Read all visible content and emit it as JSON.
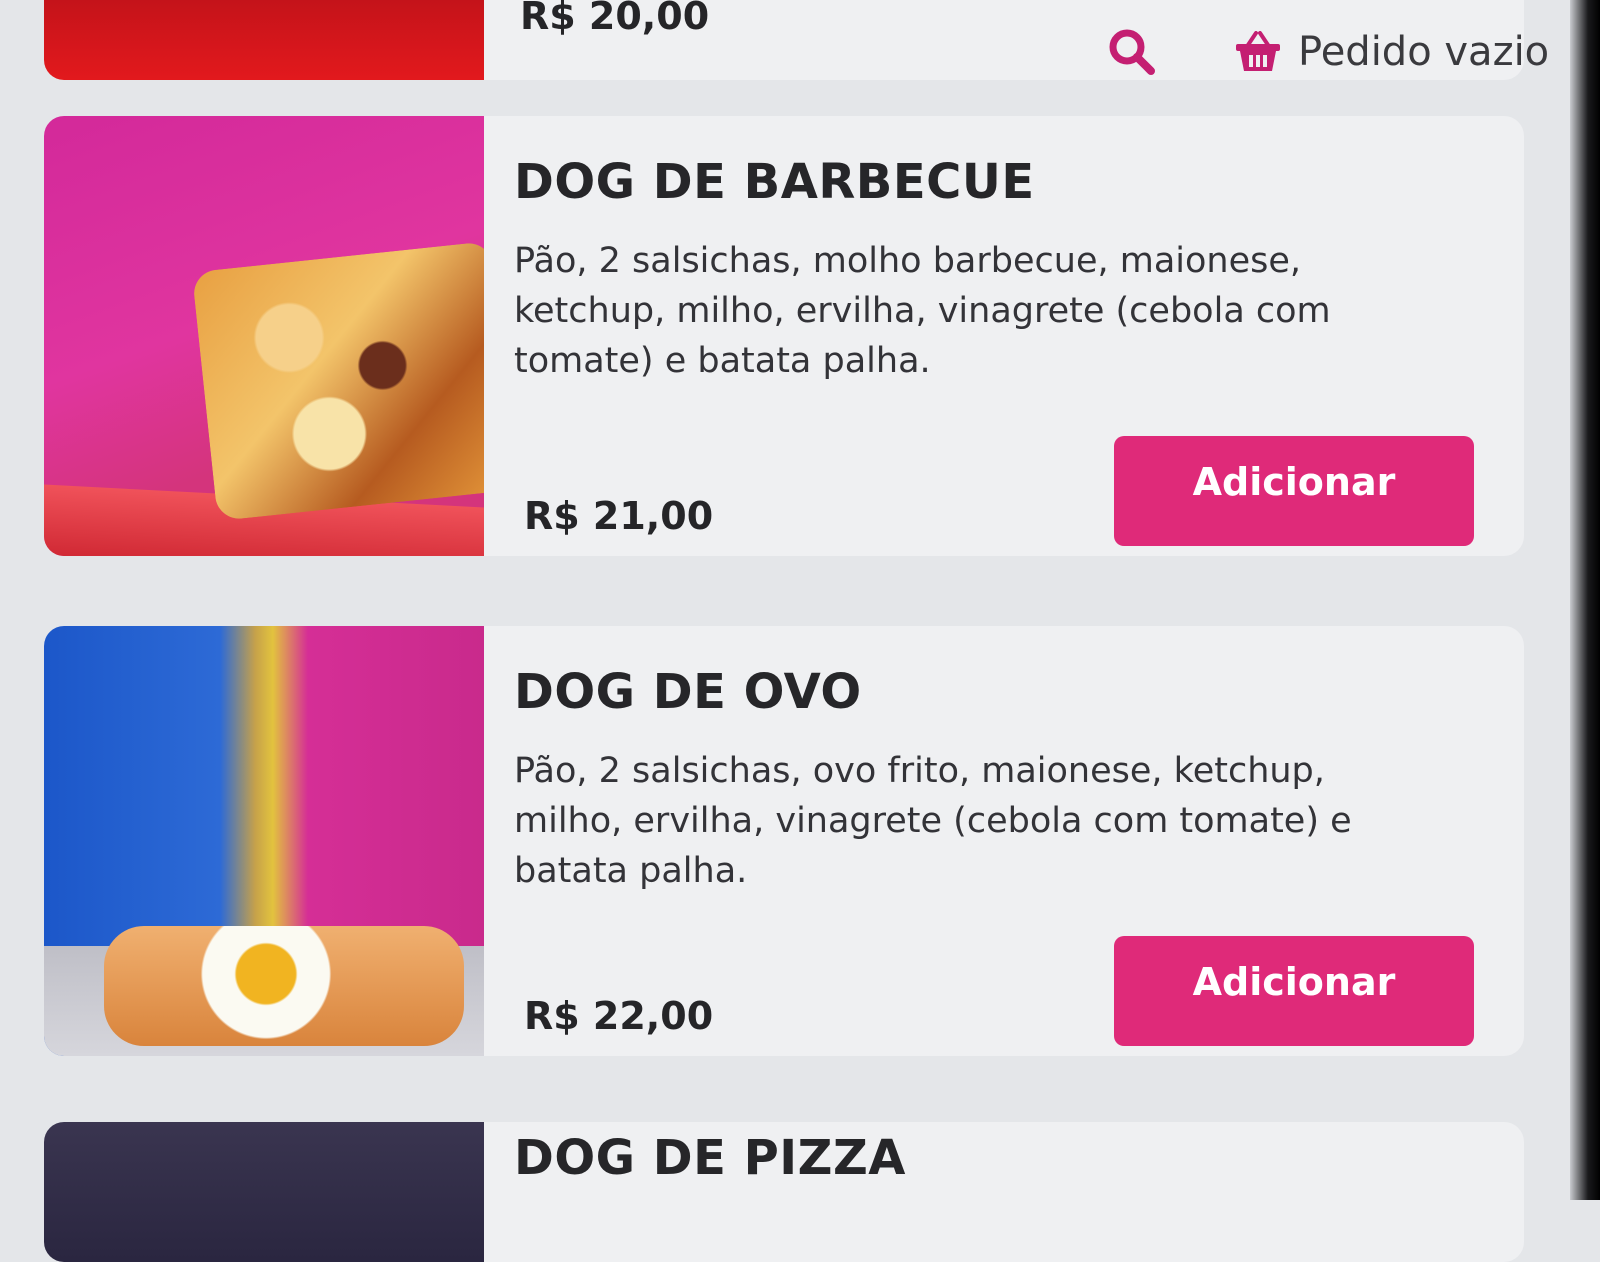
{
  "header": {
    "previous_price": "R$ 20,00",
    "search_icon": "search-icon",
    "cart_icon": "basket-icon",
    "cart_label": "Pedido vazio",
    "accent_color": "#df2a79"
  },
  "products": [
    {
      "name": "DOG DE BARBECUE",
      "description": "Pão, 2 salsichas, molho barbecue, maionese, ketchup, milho, ervilha, vinagrete (cebola com tomate) e batata palha.",
      "price": "R$ 21,00",
      "button_label": "Adicionar"
    },
    {
      "name": "DOG DE OVO",
      "description": "Pão, 2 salsichas, ovo frito, maionese, ketchup, milho, ervilha, vinagrete (cebola com tomate) e batata palha.",
      "price": "R$ 22,00",
      "button_label": "Adicionar"
    },
    {
      "name": "DOG DE PIZZA"
    }
  ]
}
